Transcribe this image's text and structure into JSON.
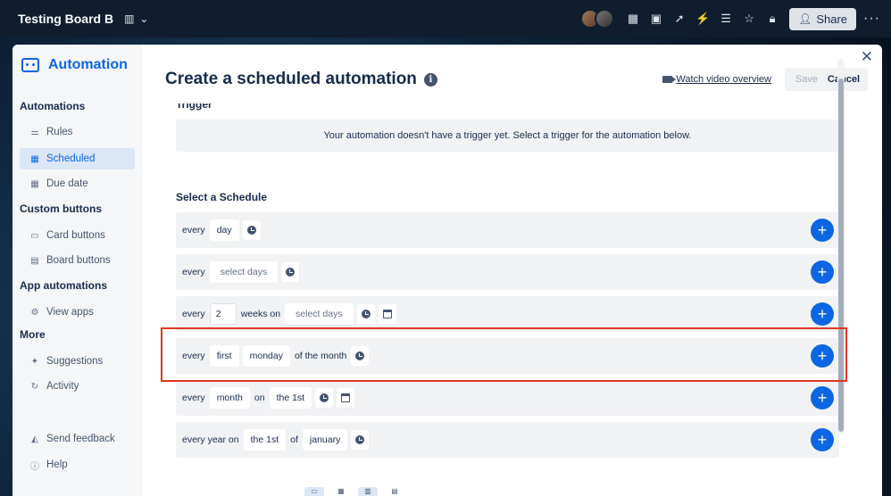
{
  "topbar": {
    "board_title": "Testing Board B",
    "share_label": "Share"
  },
  "sidebar": {
    "title": "Automation",
    "sections": [
      {
        "label": "Automations"
      },
      {
        "label": "Custom buttons"
      },
      {
        "label": "App automations"
      },
      {
        "label": "More"
      }
    ],
    "items": [
      {
        "label": "Rules",
        "icon": "rules-icon"
      },
      {
        "label": "Scheduled",
        "icon": "calendar-icon"
      },
      {
        "label": "Due date",
        "icon": "calendar-icon"
      },
      {
        "label": "Card buttons",
        "icon": "card-icon"
      },
      {
        "label": "Board buttons",
        "icon": "board-icon"
      },
      {
        "label": "View apps",
        "icon": "gear-icon"
      },
      {
        "label": "Suggestions",
        "icon": "sparkle-icon"
      },
      {
        "label": "Activity",
        "icon": "activity-icon"
      },
      {
        "label": "Send feedback",
        "icon": "megaphone-icon"
      },
      {
        "label": "Help",
        "icon": "help-icon"
      }
    ]
  },
  "header": {
    "title": "Create a scheduled automation",
    "video_link": "Watch video overview",
    "save_label": "Save",
    "cancel_label": "Cancel"
  },
  "trigger": {
    "heading_cut": "Trigger",
    "empty_message": "Your automation doesn't have a trigger yet. Select a trigger for the automation below."
  },
  "schedule": {
    "title": "Select a Schedule",
    "rows": {
      "r1": {
        "every": "every",
        "unit": "day"
      },
      "r2": {
        "every": "every",
        "days": "select days"
      },
      "r3": {
        "every": "every",
        "count": "2",
        "weeks_on": "weeks on",
        "days": "select days"
      },
      "r4": {
        "every": "every",
        "ordinal": "first",
        "weekday": "monday",
        "suffix": "of the month"
      },
      "r5": {
        "every": "every",
        "unit": "month",
        "on": "on",
        "day": "the 1st"
      },
      "r6": {
        "every": "every year on",
        "day": "the 1st",
        "of": "of",
        "month": "january"
      }
    }
  },
  "colors": {
    "accent": "#0c66e4",
    "highlight": "#e2351d"
  }
}
